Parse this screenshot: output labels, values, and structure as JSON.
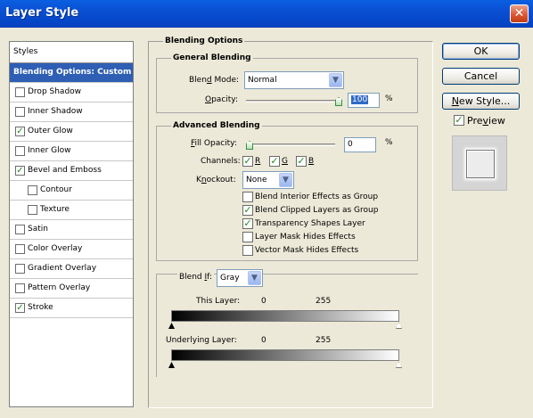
{
  "window": {
    "title": "Layer Style",
    "close_glyph": "✕"
  },
  "styles_list": {
    "header": "Styles",
    "items": [
      {
        "label": "Blending Options: Custom",
        "active": true,
        "has_checkbox": false
      },
      {
        "label": "Drop Shadow",
        "checked": false,
        "indent": false
      },
      {
        "label": "Inner Shadow",
        "checked": false,
        "indent": false
      },
      {
        "label": "Outer Glow",
        "checked": true,
        "indent": false
      },
      {
        "label": "Inner Glow",
        "checked": false,
        "indent": false
      },
      {
        "label": "Bevel and Emboss",
        "checked": true,
        "indent": false
      },
      {
        "label": "Contour",
        "checked": false,
        "indent": true
      },
      {
        "label": "Texture",
        "checked": false,
        "indent": true
      },
      {
        "label": "Satin",
        "checked": false,
        "indent": false
      },
      {
        "label": "Color Overlay",
        "checked": false,
        "indent": false
      },
      {
        "label": "Gradient Overlay",
        "checked": false,
        "indent": false
      },
      {
        "label": "Pattern Overlay",
        "checked": false,
        "indent": false
      },
      {
        "label": "Stroke",
        "checked": true,
        "indent": false
      }
    ]
  },
  "blending_options": {
    "title": "Blending Options",
    "general": {
      "title": "General Blending",
      "blend_mode_label": "Blend Mode:",
      "blend_mode_value": "Normal",
      "opacity_label": "Opacity:",
      "opacity_value": "100",
      "opacity_unit": "%",
      "opacity_fraction": 1.0
    },
    "advanced": {
      "title": "Advanced Blending",
      "fill_opacity_label": "Fill Opacity:",
      "fill_opacity_value": "0",
      "fill_opacity_unit": "%",
      "fill_opacity_fraction": 0.0,
      "channels_label": "Channels:",
      "channels": [
        {
          "label": "R",
          "checked": true
        },
        {
          "label": "G",
          "checked": true
        },
        {
          "label": "B",
          "checked": true
        }
      ],
      "knockout_label": "Knockout:",
      "knockout_value": "None",
      "options": [
        {
          "label": "Blend Interior Effects as Group",
          "checked": false
        },
        {
          "label": "Blend Clipped Layers as Group",
          "checked": true
        },
        {
          "label": "Transparency Shapes Layer",
          "checked": true
        },
        {
          "label": "Layer Mask Hides Effects",
          "checked": false
        },
        {
          "label": "Vector Mask Hides Effects",
          "checked": false
        }
      ]
    },
    "blend_if": {
      "label": "Blend If:",
      "value": "Gray",
      "this_layer_label": "This Layer:",
      "this_layer_min": "0",
      "this_layer_max": "255",
      "underlying_label": "Underlying Layer:",
      "underlying_min": "0",
      "underlying_max": "255"
    }
  },
  "buttons": {
    "ok": "OK",
    "cancel": "Cancel",
    "new_style": "New Style..."
  },
  "preview": {
    "label": "Preview",
    "checked": true
  },
  "colors": {
    "title_bar": "#0a4fd3",
    "selection": "#2f5fb4",
    "checkmark": "#1f8c1f",
    "dialog_bg": "#ece9d8"
  }
}
